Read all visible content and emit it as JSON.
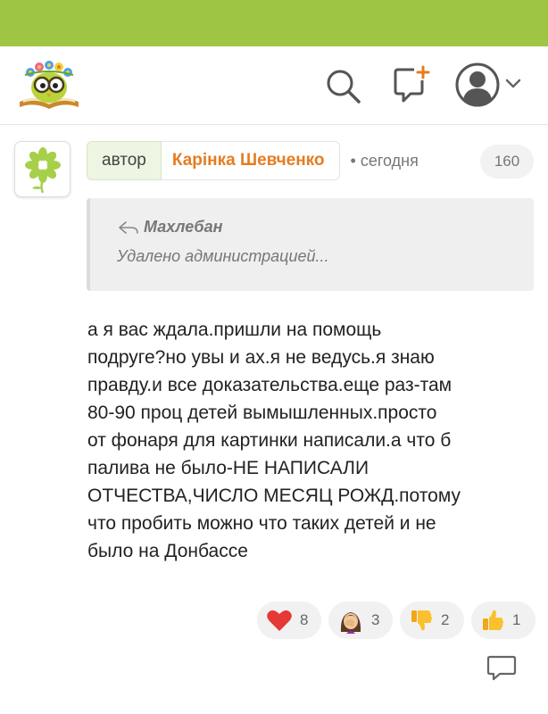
{
  "header": {
    "logo_icon": "owl-with-glasses-on-book-logo",
    "search_icon": "search-icon",
    "compose_icon": "new-message-icon",
    "avatar_icon": "user-avatar-icon",
    "menu_icon": "chevron-down-icon",
    "brand_color": "#9ec644"
  },
  "comment": {
    "avatar_icon": "green-flower-icon",
    "author_badge": "автор",
    "author_name": "Карінка Шевченко",
    "separator": "•",
    "timestamp": "сегодня",
    "comment_number": "160",
    "quote": {
      "reply_icon": "reply-arrow-icon",
      "author": "Махлебан",
      "text": "Удалено администрацией..."
    },
    "text": "а я вас ждала.пришли на помощь\nподруге?но увы и ах.я не ведусь.я знаю\nправду.и все доказательства.еще раз-там\n80-90 проц детей вымышленных.просто\nот фонаря для картинки написали.а что б\nпалива не было-НЕ НАПИСАЛИ\nОТЧЕСТВА,ЧИСЛО МЕСЯЦ РОЖД.потому\nчто пробить можно что таких детей и не\nбыло на Донбассе",
    "reactions": [
      {
        "icon": "red-heart-icon",
        "count": "8"
      },
      {
        "icon": "facepalm-woman-icon",
        "count": "3"
      },
      {
        "icon": "thumbs-down-icon",
        "count": "2"
      },
      {
        "icon": "thumbs-up-icon",
        "count": "1"
      }
    ],
    "reply_icon": "reply-speech-bubble-icon",
    "accent_color": "#e57c22"
  }
}
